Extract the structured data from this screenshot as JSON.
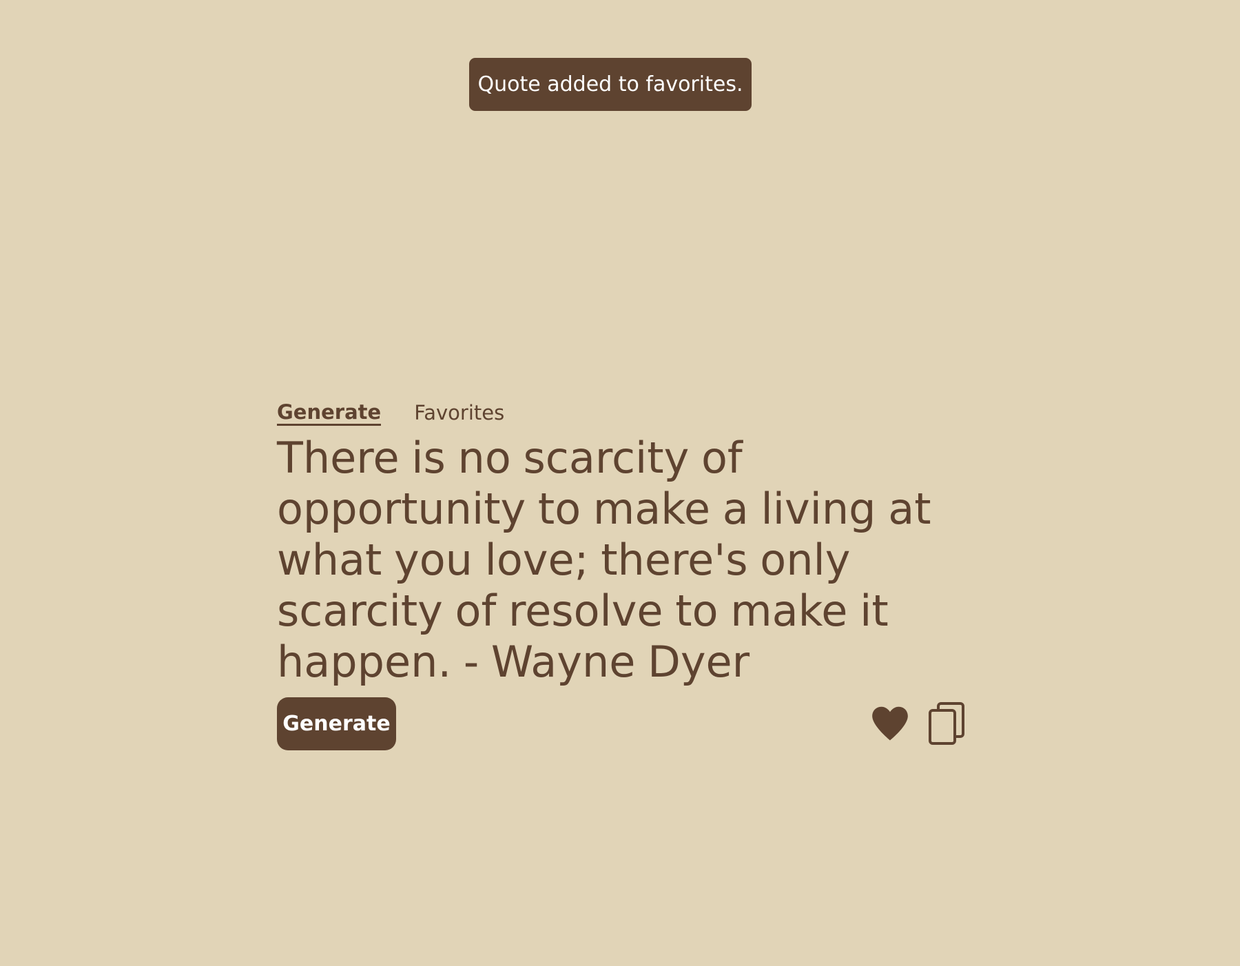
{
  "toast": {
    "message": "Quote added to favorites."
  },
  "tabs": [
    {
      "label": "Generate",
      "active": true
    },
    {
      "label": "Favorites",
      "active": false
    }
  ],
  "quote": {
    "text": "There is no scarcity of opportunity to make a living at what you love; there's only scarcity of resolve to make it happen. - Wayne Dyer"
  },
  "actions": {
    "generate_label": "Generate",
    "favorite_icon": "heart-icon",
    "copy_icon": "copy-icon",
    "favorited": true
  },
  "colors": {
    "background": "#e1d4b7",
    "primary": "#5e4330",
    "button_text": "#ffffff"
  }
}
